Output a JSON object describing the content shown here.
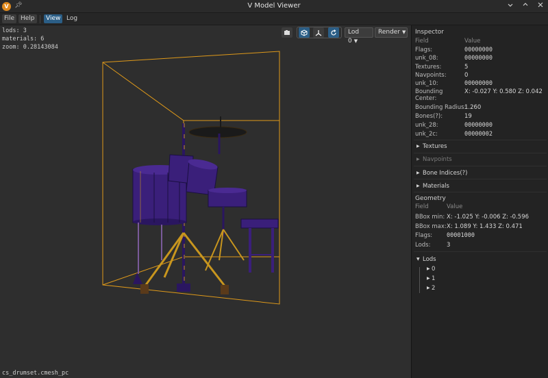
{
  "window": {
    "title": "V Model Viewer",
    "icons": {
      "app": "app-logo-icon",
      "pin": "pin-icon",
      "minimize": "minimize-icon",
      "maximize": "maximize-icon",
      "close": "close-icon"
    }
  },
  "menu": {
    "file": "File",
    "help": "Help",
    "view": "View",
    "log": "Log"
  },
  "viewport": {
    "stats": [
      "lods: 3",
      "materials: 6",
      "zoom: 0.28143084"
    ],
    "filename": "cs_drumset.cmesh_pc",
    "toolbar": {
      "icons": [
        "screenshot-icon",
        "cube-icon",
        "axes-icon",
        "reset-view-icon"
      ],
      "lod_select": "Lod 0",
      "render_select": "Render"
    },
    "colors": {
      "bbox": "#e09a1a",
      "kit_purple": "#3a1f7a",
      "hardware": "#c8961e",
      "background": "#2e2e2e"
    }
  },
  "inspector": {
    "title": "Inspector",
    "columns": {
      "field": "Field",
      "value": "Value"
    },
    "fields": [
      {
        "field": "Flags:",
        "value": "00000000",
        "mono": true
      },
      {
        "field": "unk_08:",
        "value": "00000000",
        "mono": true
      },
      {
        "field": "Textures:",
        "value": "5",
        "mono": false
      },
      {
        "field": "Navpoints:",
        "value": "0",
        "mono": false
      },
      {
        "field": "unk_10:",
        "value": "00000000",
        "mono": true
      },
      {
        "field_line1": "Bounding",
        "field_line2": "Center:",
        "value": "X: -0.027  Y: 0.580  Z: 0.042",
        "mono": false
      },
      {
        "field": "Bounding Radius:",
        "value": "1.260",
        "mono": false
      },
      {
        "field": "Bones(?):",
        "value": "19",
        "mono": false
      },
      {
        "field": "unk_28:",
        "value": "00000000",
        "mono": true
      },
      {
        "field": "unk_2c:",
        "value": "00000002",
        "mono": true
      }
    ],
    "sections": {
      "textures": "Textures",
      "navpoints": "Navpoints",
      "bone_indices": "Bone Indices(?)",
      "materials": "Materials"
    },
    "geometry": {
      "title": "Geometry",
      "columns": {
        "field": "Field",
        "value": "Value"
      },
      "bbox_min_label": "BBox min:",
      "bbox_min": "X: -1.025  Y: -0.006  Z: -0.596",
      "bbox_max_label": "BBox max:",
      "bbox_max": "X: 1.089  Y: 1.433  Z: 0.471",
      "flags_label": "Flags:",
      "flags": "00001000",
      "lods_label": "Lods:",
      "lods": "3"
    },
    "lods_tree": {
      "label": "Lods",
      "children": [
        "0",
        "1",
        "2"
      ]
    }
  }
}
